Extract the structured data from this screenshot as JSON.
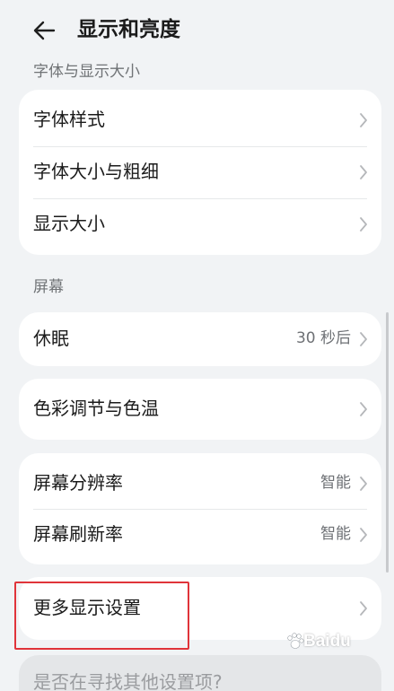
{
  "header": {
    "title": "显示和亮度",
    "back_icon": "arrow-left-icon"
  },
  "sections": {
    "font": {
      "label": "字体与显示大小",
      "items": [
        {
          "label": "字体样式"
        },
        {
          "label": "字体大小与粗细"
        },
        {
          "label": "显示大小"
        }
      ]
    },
    "screen": {
      "label": "屏幕",
      "sleep": {
        "label": "休眠",
        "value": "30 秒后"
      },
      "color": {
        "label": "色彩调节与色温"
      },
      "resolution": {
        "label": "屏幕分辨率",
        "value": "智能"
      },
      "refresh": {
        "label": "屏幕刷新率",
        "value": "智能"
      },
      "more": {
        "label": "更多显示设置"
      }
    }
  },
  "bottom_partial_text": "是否在寻找其他设置项?",
  "watermark": "Baidu",
  "colors": {
    "highlight_border": "#e0343a",
    "background": "#f1f3f5",
    "card": "#ffffff"
  }
}
